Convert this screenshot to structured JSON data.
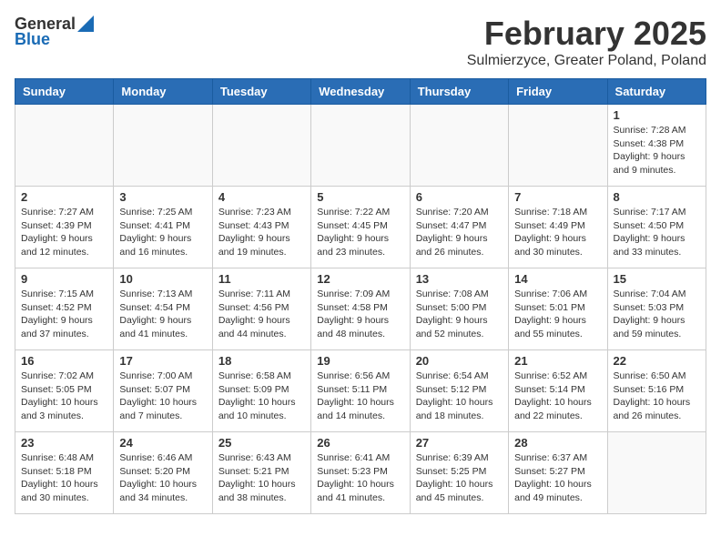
{
  "logo": {
    "general": "General",
    "blue": "Blue"
  },
  "title": "February 2025",
  "subtitle": "Sulmierzyce, Greater Poland, Poland",
  "weekdays": [
    "Sunday",
    "Monday",
    "Tuesday",
    "Wednesday",
    "Thursday",
    "Friday",
    "Saturday"
  ],
  "weeks": [
    [
      {
        "day": "",
        "info": ""
      },
      {
        "day": "",
        "info": ""
      },
      {
        "day": "",
        "info": ""
      },
      {
        "day": "",
        "info": ""
      },
      {
        "day": "",
        "info": ""
      },
      {
        "day": "",
        "info": ""
      },
      {
        "day": "1",
        "info": "Sunrise: 7:28 AM\nSunset: 4:38 PM\nDaylight: 9 hours and 9 minutes."
      }
    ],
    [
      {
        "day": "2",
        "info": "Sunrise: 7:27 AM\nSunset: 4:39 PM\nDaylight: 9 hours and 12 minutes."
      },
      {
        "day": "3",
        "info": "Sunrise: 7:25 AM\nSunset: 4:41 PM\nDaylight: 9 hours and 16 minutes."
      },
      {
        "day": "4",
        "info": "Sunrise: 7:23 AM\nSunset: 4:43 PM\nDaylight: 9 hours and 19 minutes."
      },
      {
        "day": "5",
        "info": "Sunrise: 7:22 AM\nSunset: 4:45 PM\nDaylight: 9 hours and 23 minutes."
      },
      {
        "day": "6",
        "info": "Sunrise: 7:20 AM\nSunset: 4:47 PM\nDaylight: 9 hours and 26 minutes."
      },
      {
        "day": "7",
        "info": "Sunrise: 7:18 AM\nSunset: 4:49 PM\nDaylight: 9 hours and 30 minutes."
      },
      {
        "day": "8",
        "info": "Sunrise: 7:17 AM\nSunset: 4:50 PM\nDaylight: 9 hours and 33 minutes."
      }
    ],
    [
      {
        "day": "9",
        "info": "Sunrise: 7:15 AM\nSunset: 4:52 PM\nDaylight: 9 hours and 37 minutes."
      },
      {
        "day": "10",
        "info": "Sunrise: 7:13 AM\nSunset: 4:54 PM\nDaylight: 9 hours and 41 minutes."
      },
      {
        "day": "11",
        "info": "Sunrise: 7:11 AM\nSunset: 4:56 PM\nDaylight: 9 hours and 44 minutes."
      },
      {
        "day": "12",
        "info": "Sunrise: 7:09 AM\nSunset: 4:58 PM\nDaylight: 9 hours and 48 minutes."
      },
      {
        "day": "13",
        "info": "Sunrise: 7:08 AM\nSunset: 5:00 PM\nDaylight: 9 hours and 52 minutes."
      },
      {
        "day": "14",
        "info": "Sunrise: 7:06 AM\nSunset: 5:01 PM\nDaylight: 9 hours and 55 minutes."
      },
      {
        "day": "15",
        "info": "Sunrise: 7:04 AM\nSunset: 5:03 PM\nDaylight: 9 hours and 59 minutes."
      }
    ],
    [
      {
        "day": "16",
        "info": "Sunrise: 7:02 AM\nSunset: 5:05 PM\nDaylight: 10 hours and 3 minutes."
      },
      {
        "day": "17",
        "info": "Sunrise: 7:00 AM\nSunset: 5:07 PM\nDaylight: 10 hours and 7 minutes."
      },
      {
        "day": "18",
        "info": "Sunrise: 6:58 AM\nSunset: 5:09 PM\nDaylight: 10 hours and 10 minutes."
      },
      {
        "day": "19",
        "info": "Sunrise: 6:56 AM\nSunset: 5:11 PM\nDaylight: 10 hours and 14 minutes."
      },
      {
        "day": "20",
        "info": "Sunrise: 6:54 AM\nSunset: 5:12 PM\nDaylight: 10 hours and 18 minutes."
      },
      {
        "day": "21",
        "info": "Sunrise: 6:52 AM\nSunset: 5:14 PM\nDaylight: 10 hours and 22 minutes."
      },
      {
        "day": "22",
        "info": "Sunrise: 6:50 AM\nSunset: 5:16 PM\nDaylight: 10 hours and 26 minutes."
      }
    ],
    [
      {
        "day": "23",
        "info": "Sunrise: 6:48 AM\nSunset: 5:18 PM\nDaylight: 10 hours and 30 minutes."
      },
      {
        "day": "24",
        "info": "Sunrise: 6:46 AM\nSunset: 5:20 PM\nDaylight: 10 hours and 34 minutes."
      },
      {
        "day": "25",
        "info": "Sunrise: 6:43 AM\nSunset: 5:21 PM\nDaylight: 10 hours and 38 minutes."
      },
      {
        "day": "26",
        "info": "Sunrise: 6:41 AM\nSunset: 5:23 PM\nDaylight: 10 hours and 41 minutes."
      },
      {
        "day": "27",
        "info": "Sunrise: 6:39 AM\nSunset: 5:25 PM\nDaylight: 10 hours and 45 minutes."
      },
      {
        "day": "28",
        "info": "Sunrise: 6:37 AM\nSunset: 5:27 PM\nDaylight: 10 hours and 49 minutes."
      },
      {
        "day": "",
        "info": ""
      }
    ]
  ]
}
